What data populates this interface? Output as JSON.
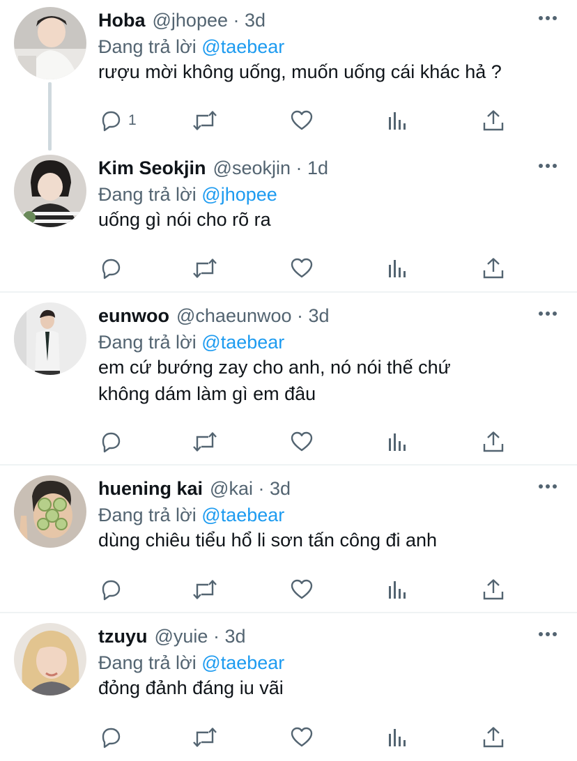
{
  "replying_prefix": "Đang trả lời",
  "tweets": [
    {
      "name": "Hoba",
      "handle": "@jhopee",
      "time": "3d",
      "reply_to": "@taebear",
      "lines": [
        "rượu mời không uống, muốn uống cái khác hả ?"
      ],
      "reply_count": "1"
    },
    {
      "name": "Kim Seokjin",
      "handle": "@seokjin",
      "time": "1d",
      "reply_to": "@jhopee",
      "lines": [
        "uống gì nói cho rõ ra"
      ],
      "reply_count": ""
    },
    {
      "name": "eunwoo",
      "handle": "@chaeunwoo",
      "time": "3d",
      "reply_to": "@taebear",
      "lines": [
        "em cứ bướng zay cho anh, nó nói thế chứ",
        "không dám làm gì em đâu"
      ],
      "reply_count": ""
    },
    {
      "name": "huening kai",
      "handle": "@kai",
      "time": "3d",
      "reply_to": "@taebear",
      "lines": [
        "dùng chiêu tiểu hổ li sơn tấn công đi anh"
      ],
      "reply_count": ""
    },
    {
      "name": "tzuyu",
      "handle": "@yuie",
      "time": "3d",
      "reply_to": "@taebear",
      "lines": [
        "đỏng đảnh đáng iu vãi"
      ],
      "reply_count": ""
    }
  ],
  "icons": {
    "reply": "reply-icon",
    "retweet": "retweet-icon",
    "like": "heart-icon",
    "analytics": "analytics-icon",
    "share": "share-icon",
    "more": "more-icon"
  },
  "colors": {
    "text": "#0f1419",
    "secondary": "#536471",
    "mention": "#1d9bf0",
    "divider": "#eff3f4",
    "thread_line": "#cfd9de"
  }
}
